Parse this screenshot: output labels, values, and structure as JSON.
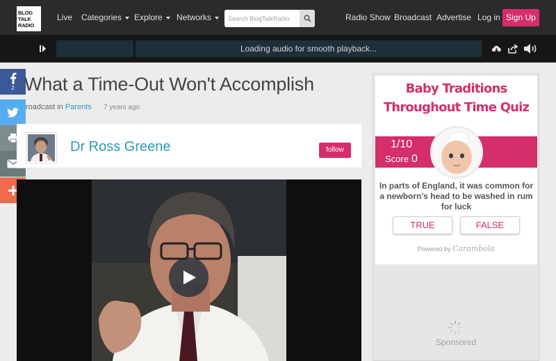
{
  "header": {
    "logo_lines": [
      "BLOG",
      "TALK",
      "RADIO"
    ],
    "nav": {
      "live": "Live",
      "categories": "Categories",
      "explore": "Explore",
      "networks": "Networks"
    },
    "search_placeholder": "Search BlogTalkRadio",
    "right": {
      "radio_show": "Radio Show",
      "broadcast": "Broadcast",
      "advertise": "Advertise",
      "login": "Log in",
      "signup": "Sign Up"
    }
  },
  "player": {
    "status_text": "Loading audio for smooth playback..."
  },
  "share": {
    "facebook_count": "2"
  },
  "episode": {
    "title": "What a Time-Out Won't Accomplish",
    "meta_prefix": "roadcast in",
    "category": "Parents",
    "time_ago": "7 years ago",
    "host_name": "Dr Ross Greene",
    "follow_label": "follow"
  },
  "quiz": {
    "title_line1": "Baby Traditions",
    "title_line2": "Throughout Time Quiz",
    "progress": "1/10",
    "score_label": "Score",
    "score_value": "0",
    "question": "In parts of England, it was common for a newborn's head to be washed in rum for luck",
    "true_label": "TRUE",
    "false_label": "FALSE",
    "powered_by": "Powered by",
    "powered_brand": "Carambola"
  },
  "sidebar": {
    "sponsored_label": "Sponsored"
  },
  "colors": {
    "brand_pink": "#d42e6b",
    "link_blue": "#2d9ab5",
    "nav_bg": "#2b2b2b",
    "player_bg": "#161616"
  }
}
